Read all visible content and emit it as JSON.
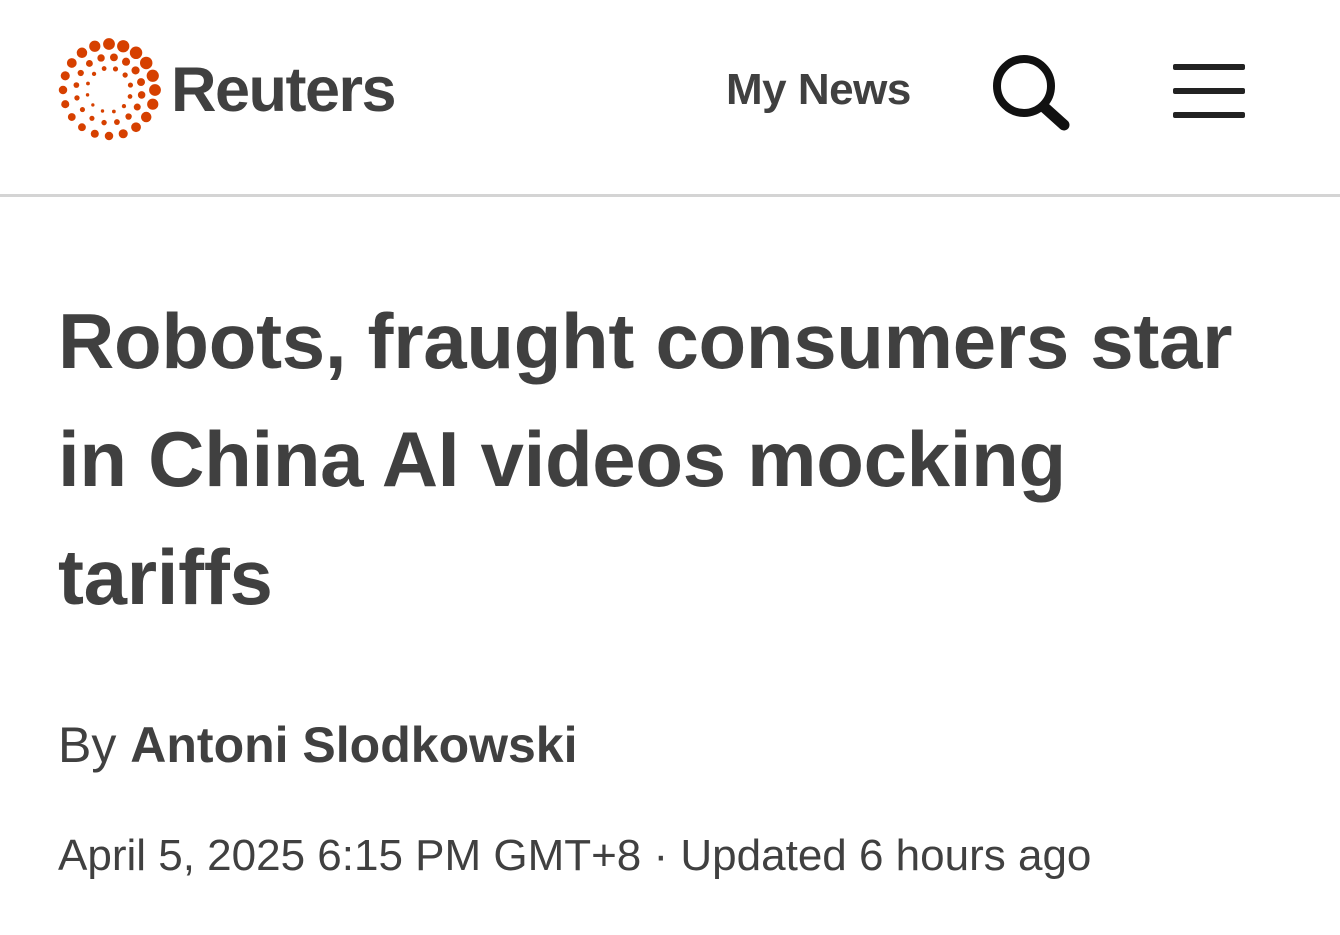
{
  "header": {
    "brand_name": "Reuters",
    "brand_color": "#d64000",
    "nav_label": "My News",
    "search_icon": "search-icon",
    "menu_icon": "hamburger-menu-icon"
  },
  "article": {
    "headline": "Robots, fraught consumers star in China AI videos mocking tariffs",
    "byline_prefix": "By",
    "author": "Antoni Slodkowski",
    "published": "April 5, 2025 6:15 PM GMT+8",
    "separator": "·",
    "updated": "Updated 6 hours ago"
  }
}
